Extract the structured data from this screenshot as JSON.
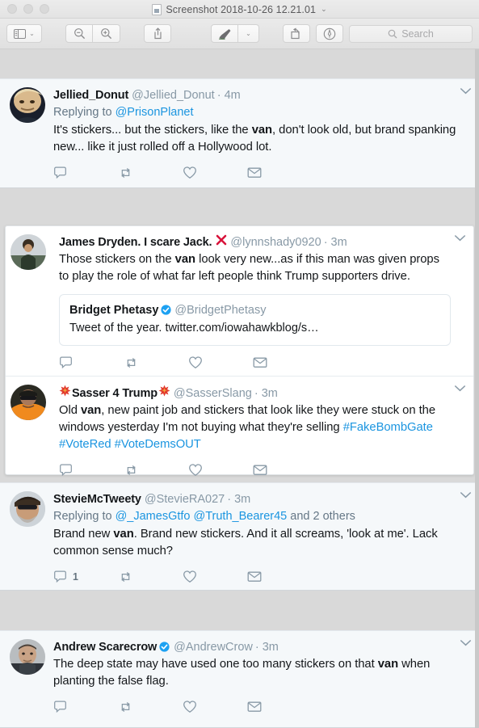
{
  "window": {
    "title": "Screenshot 2018-10-26 12.21.01",
    "title_chevron": "⌄",
    "traffic_lights": [
      "close",
      "minimize",
      "maximize"
    ]
  },
  "toolbar": {
    "sidebar_label": "sidebar-view",
    "sidebar_chevron": "⌄",
    "zoom_out_label": "zoom-out",
    "zoom_in_label": "zoom-in",
    "share_label": "share",
    "markup_label": "markup",
    "markup_chevron": "⌄",
    "rotate_label": "rotate",
    "annotate_label": "annotate",
    "search": {
      "placeholder": "Search",
      "value": ""
    }
  },
  "tweets": [
    {
      "id": "jellied-donut",
      "name": "Jellied_Donut",
      "name_emoji": null,
      "verified": false,
      "handle": "@Jellied_Donut",
      "time": "· 4m",
      "replying_prefix": "Replying to ",
      "replying_to": [
        "@PrisonPlanet"
      ],
      "body_parts": [
        {
          "t": "It's stickers... but the stickers, like the ",
          "s": "plain"
        },
        {
          "t": "van",
          "s": "bold"
        },
        {
          "t": ", don't look old, but brand spanking new... like it just rolled off a Hollywood lot.",
          "s": "plain"
        }
      ],
      "quote": null,
      "actions": {
        "reply": "",
        "retweet": "",
        "like": "",
        "message": ""
      },
      "caret": "⌄"
    },
    {
      "id": "james-dryden",
      "name": "James Dryden. I scare Jack.",
      "name_emoji": "cross-mark",
      "verified": false,
      "handle": "@lynnshady0920",
      "time": "· 3m",
      "replying_prefix": null,
      "replying_to": [],
      "body_parts": [
        {
          "t": "Those stickers on the ",
          "s": "plain"
        },
        {
          "t": "van",
          "s": "bold"
        },
        {
          "t": " look very new...as if this man was given props to play the role of what far left people think Trump supporters drive.",
          "s": "plain"
        }
      ],
      "quote": {
        "name": "Bridget Phetasy",
        "verified": true,
        "handle": "@BridgetPhetasy",
        "body": "Tweet of the year. twitter.com/iowahawkblog/s…"
      },
      "actions": {
        "reply": "",
        "retweet": "",
        "like": "",
        "message": ""
      },
      "caret": "⌄"
    },
    {
      "id": "sasser-4-trump",
      "name": "Sasser 4 Trump",
      "name_emoji": "collision",
      "name_emoji_both": true,
      "verified": false,
      "handle": "@SasserSlang",
      "time": "· 3m",
      "replying_prefix": null,
      "replying_to": [],
      "body_parts": [
        {
          "t": "Old ",
          "s": "plain"
        },
        {
          "t": "van",
          "s": "bold"
        },
        {
          "t": ", new paint job and stickers that look like they were stuck on the windows yesterday I'm not buying what they're selling ",
          "s": "plain"
        },
        {
          "t": "#FakeBombGate",
          "s": "link"
        },
        {
          "t": " ",
          "s": "plain"
        },
        {
          "t": "#VoteRed",
          "s": "link"
        },
        {
          "t": " ",
          "s": "plain"
        },
        {
          "t": "#VoteDemsOUT",
          "s": "link"
        }
      ],
      "quote": null,
      "actions": {
        "reply": "",
        "retweet": "",
        "like": "",
        "message": ""
      },
      "caret": "⌄"
    },
    {
      "id": "stevie-mctweety",
      "name": "StevieMcTweety",
      "name_emoji": null,
      "verified": false,
      "handle": "@StevieRA027",
      "time": "· 3m",
      "replying_prefix": "Replying to ",
      "replying_to": [
        "@_JamesGtfo",
        "@Truth_Bearer45"
      ],
      "replying_suffix": " and 2 others",
      "body_parts": [
        {
          "t": "Brand new ",
          "s": "plain"
        },
        {
          "t": "van",
          "s": "bold"
        },
        {
          "t": ".  Brand new stickers.  And it all screams, 'look at me'.  Lack common sense much?",
          "s": "plain"
        }
      ],
      "quote": null,
      "actions": {
        "reply": "1",
        "retweet": "",
        "like": "",
        "message": ""
      },
      "caret": "⌄"
    },
    {
      "id": "andrew-scarecrow",
      "name": "Andrew Scarecrow",
      "name_emoji": null,
      "verified": true,
      "handle": "@AndrewCrow",
      "time": "· 3m",
      "replying_prefix": null,
      "replying_to": [],
      "body_parts": [
        {
          "t": "The deep state may have used one too many stickers on that ",
          "s": "plain"
        },
        {
          "t": "van",
          "s": "bold"
        },
        {
          "t": " when planting the false flag.",
          "s": "plain"
        }
      ],
      "quote": null,
      "actions": {
        "reply": "",
        "retweet": "",
        "like": "",
        "message": ""
      },
      "caret": "⌄"
    }
  ],
  "colors": {
    "link": "#1b95e0",
    "verified_badge": "#1da1f2",
    "muted_text": "#8899a6",
    "text": "#14171a",
    "card_tint": "#f5f8fa",
    "page_bg": "#d9d9d9"
  }
}
